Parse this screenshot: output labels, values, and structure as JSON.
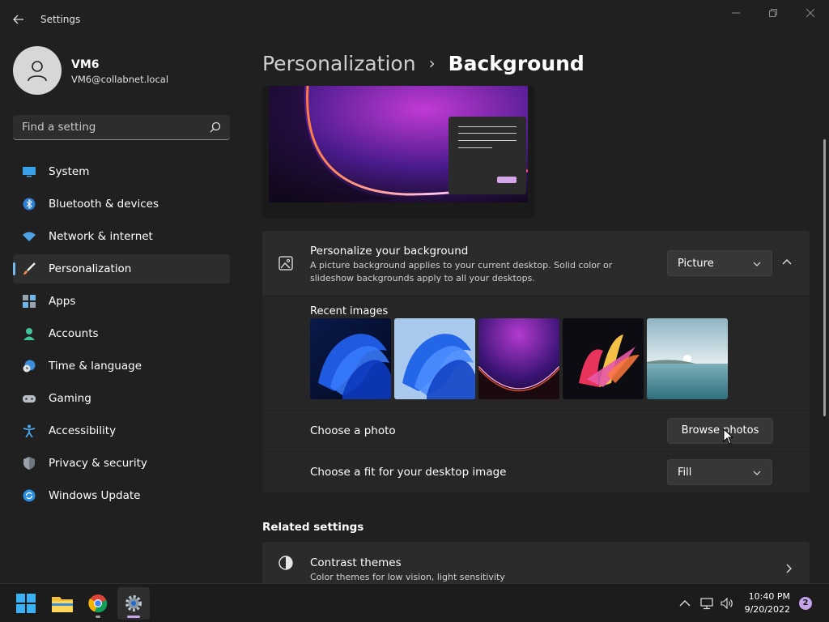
{
  "window": {
    "app_title": "Settings"
  },
  "profile": {
    "name": "VM6",
    "email": "VM6@collabnet.local"
  },
  "search": {
    "placeholder": "Find a setting"
  },
  "sidebar": {
    "items": [
      {
        "label": "System",
        "icon": "monitor-icon"
      },
      {
        "label": "Bluetooth & devices",
        "icon": "bluetooth-icon"
      },
      {
        "label": "Network & internet",
        "icon": "wifi-icon"
      },
      {
        "label": "Personalization",
        "icon": "paintbrush-icon",
        "active": true
      },
      {
        "label": "Apps",
        "icon": "apps-icon"
      },
      {
        "label": "Accounts",
        "icon": "person-icon"
      },
      {
        "label": "Time & language",
        "icon": "clock-globe-icon"
      },
      {
        "label": "Gaming",
        "icon": "gamepad-icon"
      },
      {
        "label": "Accessibility",
        "icon": "accessibility-icon"
      },
      {
        "label": "Privacy & security",
        "icon": "shield-icon"
      },
      {
        "label": "Windows Update",
        "icon": "sync-icon"
      }
    ]
  },
  "breadcrumb": {
    "parent": "Personalization",
    "separator": "›",
    "current": "Background"
  },
  "background_card": {
    "title": "Personalize your background",
    "description": "A picture background applies to your current desktop. Solid color or slideshow backgrounds apply to all your desktops.",
    "dropdown_value": "Picture",
    "recent_label": "Recent images",
    "recent_images": [
      "bloom-dark-blue",
      "bloom-light-blue",
      "glow-purple",
      "ribbon-colorful",
      "lake-sunrise"
    ]
  },
  "choose_photo": {
    "label": "Choose a photo",
    "button_label": "Browse photos"
  },
  "fit": {
    "label": "Choose a fit for your desktop image",
    "dropdown_value": "Fill"
  },
  "related": {
    "heading": "Related settings",
    "contrast_title": "Contrast themes",
    "contrast_desc": "Color themes for low vision, light sensitivity"
  },
  "taskbar": {
    "time": "10:40 PM",
    "date": "9/20/2022",
    "notification_count": "2"
  },
  "colors": {
    "background": "#202020",
    "card": "#2b2b2b",
    "accent": "#76b9ed"
  }
}
